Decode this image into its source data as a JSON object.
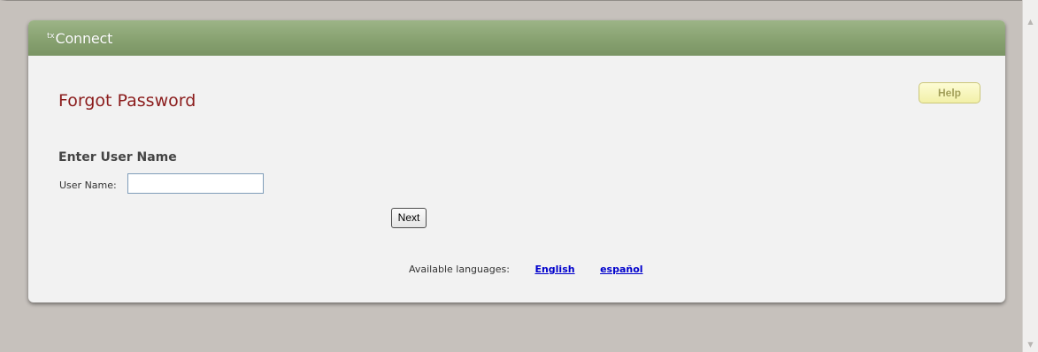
{
  "app": {
    "brand_prefix": "tx",
    "brand_name": "Connect"
  },
  "page": {
    "title": "Forgot Password",
    "help_label": "Help"
  },
  "form": {
    "section_heading": "Enter User Name",
    "username_label": "User Name:",
    "username_value": "",
    "next_label": "Next"
  },
  "languages": {
    "label": "Available languages:",
    "options": [
      "English",
      "español"
    ]
  },
  "colors": {
    "header_green": "#86a06f",
    "title_red": "#8b1c1c",
    "help_yellow": "#f2f0a8",
    "link_blue": "#0000cc"
  }
}
